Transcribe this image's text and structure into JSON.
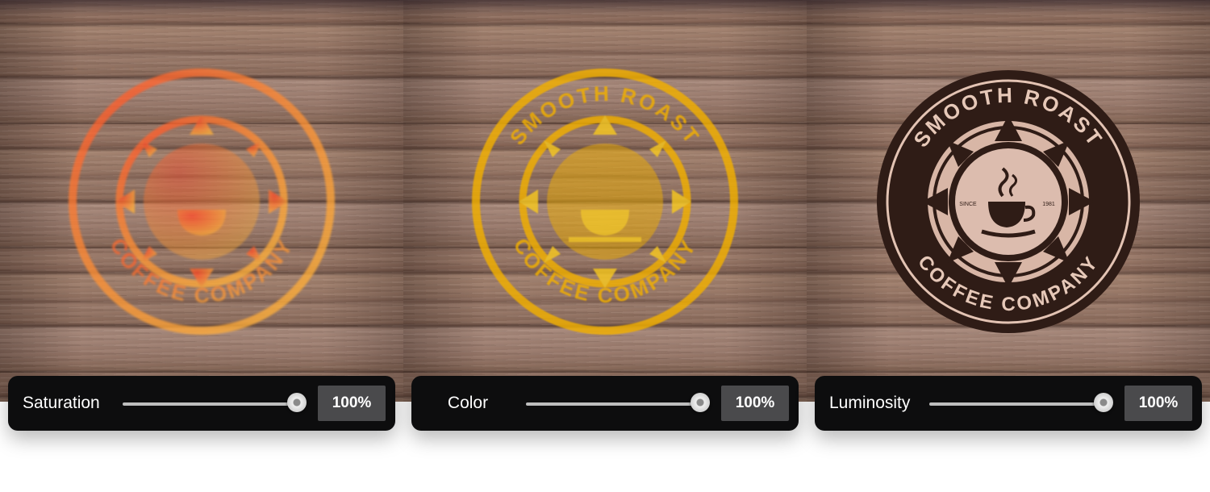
{
  "panels": [
    {
      "blend_mode": "Saturation",
      "value": "100%",
      "slider_fraction": 1.0,
      "logo_colors": [
        "#ff4a2a",
        "#ffb23a"
      ]
    },
    {
      "blend_mode": "Color",
      "value": "100%",
      "slider_fraction": 1.0,
      "logo_colors": [
        "#f2b000",
        "#f7c820"
      ]
    },
    {
      "blend_mode": "Luminosity",
      "value": "100%",
      "slider_fraction": 1.0,
      "logo_colors": [
        "#2a1812",
        "#e6c8b8"
      ]
    }
  ],
  "logo": {
    "top_text": "SMOOTH ROAST",
    "bottom_text": "COFFEE COMPANY",
    "since_text": "SINCE",
    "year_text": "1981"
  }
}
